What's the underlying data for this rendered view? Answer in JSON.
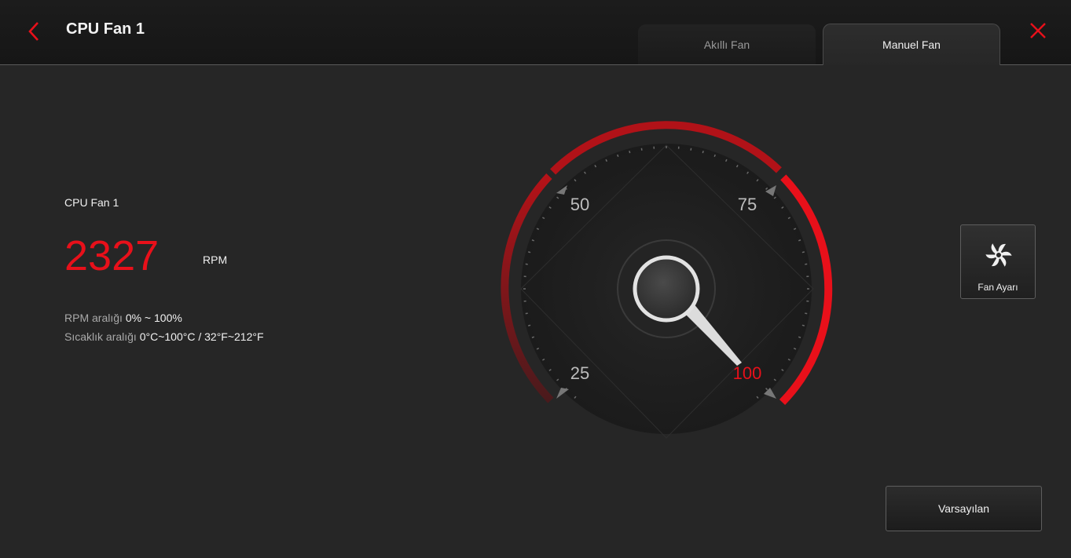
{
  "header": {
    "title": "CPU Fan 1",
    "tabs": [
      {
        "label": "Akıllı Fan",
        "active": false
      },
      {
        "label": "Manuel Fan",
        "active": true
      }
    ]
  },
  "fan_info": {
    "name": "CPU Fan 1",
    "rpm_value": "2327",
    "rpm_unit": "RPM",
    "rpm_range_label": "RPM aralığı",
    "rpm_range_value": "0% ~ 100%",
    "temp_range_label": "Sıcaklık aralığı",
    "temp_range_value": "0°C~100°C / 32°F~212°F"
  },
  "gauge": {
    "labels": [
      "25",
      "50",
      "75",
      "100"
    ],
    "current_percent": 100,
    "active_label": "100"
  },
  "buttons": {
    "fan_settings": "Fan Ayarı",
    "default": "Varsayılan"
  },
  "colors": {
    "accent": "#e8101a",
    "background": "#262626"
  }
}
